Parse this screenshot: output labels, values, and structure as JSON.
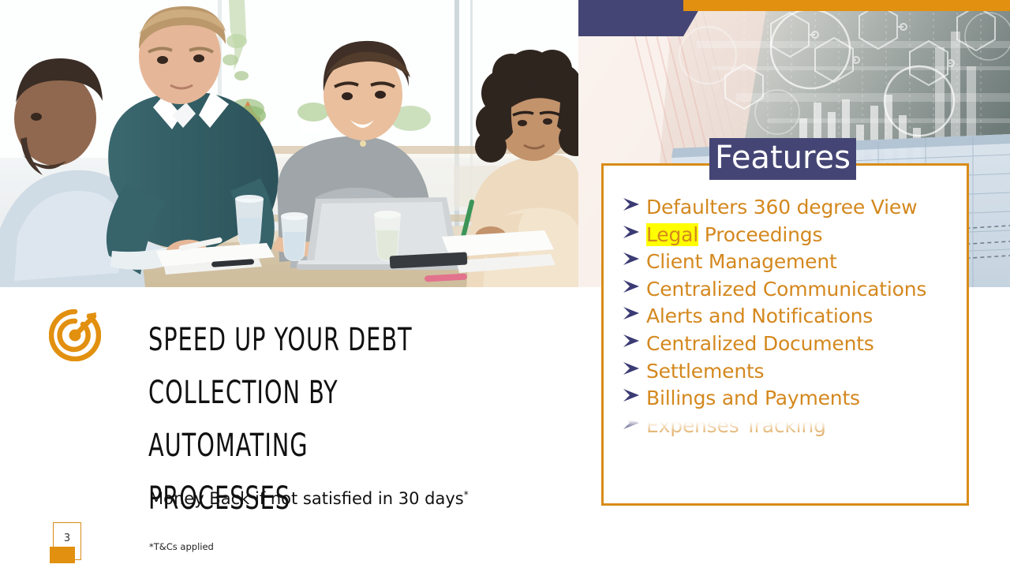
{
  "slide": {
    "number": "3",
    "accent_orange": "#d88c18",
    "accent_navy": "#454575",
    "bullet_text_color": "#d4881e",
    "highlight_color": "#ffff00"
  },
  "headline": {
    "line1": "Speed up your debt",
    "line2": "collection by automating",
    "line3": "processes"
  },
  "guarantee": {
    "text": "Money Back if not satisfied in 30 days",
    "asterisk": "*",
    "footnote": "*T&Cs applied"
  },
  "features": {
    "title": "Features",
    "items": [
      {
        "label": "Defaulters 360 degree View",
        "highlight": "",
        "rest": "",
        "faded": false
      },
      {
        "label": "Legal Proceedings",
        "highlight": "Legal",
        "rest": " Proceedings",
        "faded": false
      },
      {
        "label": "Client Management",
        "highlight": "",
        "rest": "",
        "faded": false
      },
      {
        "label": "Centralized Communications",
        "highlight": "",
        "rest": "",
        "faded": false
      },
      {
        "label": "Alerts and Notifications",
        "highlight": "",
        "rest": "",
        "faded": false
      },
      {
        "label": "Centralized Documents",
        "highlight": "",
        "rest": "",
        "faded": false
      },
      {
        "label": "Settlements",
        "highlight": "",
        "rest": "",
        "faded": false
      },
      {
        "label": "Billings and Payments",
        "highlight": "",
        "rest": "",
        "faded": false
      },
      {
        "label": "Expenses Tracking",
        "highlight": "",
        "rest": "",
        "faded": true
      }
    ]
  },
  "icons": {
    "target": "target-arrow-icon",
    "bullet": "arrowhead-bullet-icon"
  },
  "photo": {
    "description": "business-team-meeting-photo"
  }
}
